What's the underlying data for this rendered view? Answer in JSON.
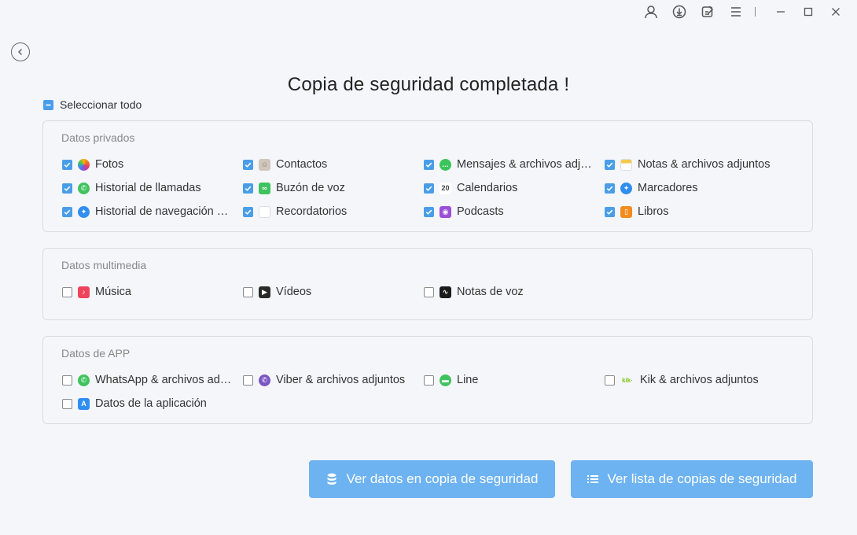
{
  "title": "Copia de seguridad completada !",
  "select_all": {
    "label": "Seleccionar todo",
    "state": "partial"
  },
  "sections": {
    "private": {
      "title": "Datos privados",
      "items": [
        {
          "label": "Fotos",
          "icon": "photos-icon",
          "checked": true
        },
        {
          "label": "Contactos",
          "icon": "contacts-icon",
          "checked": true
        },
        {
          "label": "Mensajes & archivos adjuntos",
          "icon": "messages-icon",
          "checked": true
        },
        {
          "label": "Notas & archivos adjuntos",
          "icon": "notes-icon",
          "checked": true
        },
        {
          "label": "Historial de llamadas",
          "icon": "phone-icon",
          "checked": true
        },
        {
          "label": "Buzón de voz",
          "icon": "voicemail-icon",
          "checked": true
        },
        {
          "label": "Calendarios",
          "icon": "calendar-icon",
          "checked": true,
          "icon_text": "20"
        },
        {
          "label": "Marcadores",
          "icon": "safari-icon",
          "checked": true
        },
        {
          "label": "Historial de navegación de Safari",
          "icon": "safari-history-icon",
          "checked": true
        },
        {
          "label": "Recordatorios",
          "icon": "reminders-icon",
          "checked": true
        },
        {
          "label": "Podcasts",
          "icon": "podcasts-icon",
          "checked": true
        },
        {
          "label": "Libros",
          "icon": "books-icon",
          "checked": true
        }
      ]
    },
    "multimedia": {
      "title": "Datos multimedia",
      "items": [
        {
          "label": "Música",
          "icon": "music-icon",
          "checked": false
        },
        {
          "label": "Vídeos",
          "icon": "videos-icon",
          "checked": false
        },
        {
          "label": "Notas de voz",
          "icon": "voice-memos-icon",
          "checked": false
        }
      ]
    },
    "app": {
      "title": "Datos de APP",
      "items": [
        {
          "label": "WhatsApp & archivos adjuntos",
          "icon": "whatsapp-icon",
          "checked": false
        },
        {
          "label": "Viber & archivos adjuntos",
          "icon": "viber-icon",
          "checked": false
        },
        {
          "label": "Line",
          "icon": "line-icon",
          "checked": false
        },
        {
          "label": "Kik & archivos adjuntos",
          "icon": "kik-icon",
          "checked": false,
          "icon_text": "kik·"
        },
        {
          "label": "Datos de la aplicación",
          "icon": "app-store-icon",
          "checked": false
        }
      ]
    }
  },
  "buttons": {
    "view_data": "Ver datos en copia de seguridad",
    "view_list": "Ver lista de copias de seguridad"
  },
  "colors": {
    "accent": "#4a9ee8",
    "button": "#6db3f2"
  }
}
